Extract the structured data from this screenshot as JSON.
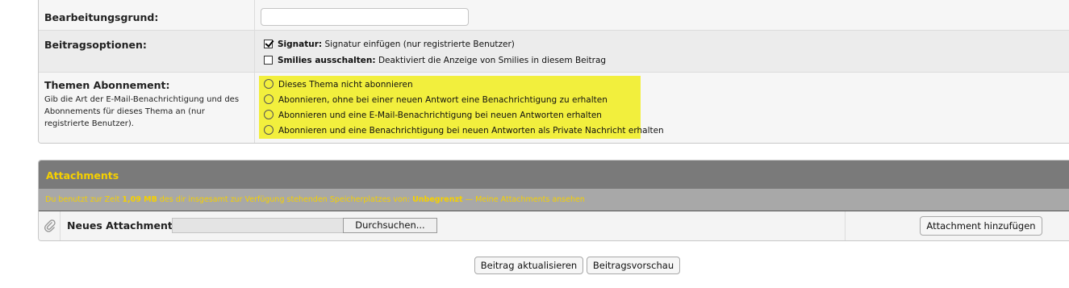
{
  "edit_reason": {
    "label": "Bearbeitungsgrund:",
    "value": "",
    "placeholder": ""
  },
  "post_options": {
    "label": "Beitragsoptionen:",
    "signature": {
      "title": "Signatur:",
      "desc": "Signatur einfügen (nur registrierte Benutzer)",
      "checked": true
    },
    "smilies": {
      "title": "Smilies ausschalten:",
      "desc": "Deaktiviert die Anzeige von Smilies in diesem Beitrag",
      "checked": false
    }
  },
  "subscription": {
    "label": "Themen Abonnement:",
    "description": "Gib die Art der E-Mail-Benachrichtigung und des Abonnements für dieses Thema an (nur registrierte Benutzer).",
    "options": [
      "Dieses Thema nicht abonnieren",
      "Abonnieren, ohne bei einer neuen Antwort eine Benachrichtigung zu erhalten",
      "Abonnieren und eine E-Mail-Benachrichtigung bei neuen Antworten erhalten",
      "Abonnieren und eine Benachrichtigung bei neuen Antworten als Private Nachricht erhalten"
    ],
    "highlight_color": "#f2ef3d"
  },
  "attachments": {
    "title": "Attachments",
    "info_pre": "Du benutzt zur Zeit ",
    "used": "1,09 MB",
    "info_mid": " des dir insgesamt zur Verfügung stehenden Speicherplatzes von: ",
    "limit": "Unbegrenzt",
    "info_link": " — Meine Attachments ansehen",
    "new_label": "Neues Attachment:",
    "browse_label": "Durchsuchen...",
    "add_label": "Attachment hinzufügen",
    "accent_color": "#f5d000"
  },
  "actions": {
    "update_label": "Beitrag aktualisieren",
    "preview_label": "Beitragsvorschau"
  }
}
